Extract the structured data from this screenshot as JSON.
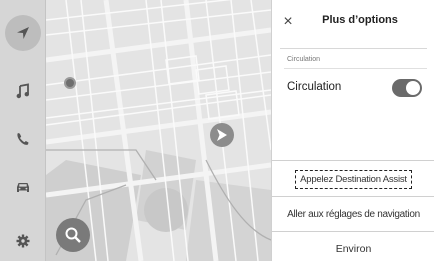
{
  "sidebar": {
    "items": [
      {
        "icon": "navigation-arrow-icon",
        "active": true
      },
      {
        "icon": "music-note-icon",
        "active": false
      },
      {
        "icon": "phone-icon",
        "active": false
      },
      {
        "icon": "car-icon",
        "active": false
      },
      {
        "icon": "gear-icon",
        "active": false
      }
    ]
  },
  "map": {
    "search_icon": "search-icon",
    "vehicle_icon": "vehicle-position-arrow-icon"
  },
  "panel": {
    "title": "Plus d’options",
    "close_icon": "close-icon",
    "close_glyph": "×",
    "section_label": "Circulation",
    "toggle_label": "Circulation",
    "toggle_on": true,
    "menu": {
      "destination_assist": "Appelez Destination Assist",
      "nav_settings": "Aller aux réglages de navigation",
      "environ": "Environ"
    }
  },
  "colors": {
    "sidebar_bg": "#d6d6d6",
    "map_bg": "#e6e6e6",
    "toggle_on": "#6a6a6a"
  }
}
